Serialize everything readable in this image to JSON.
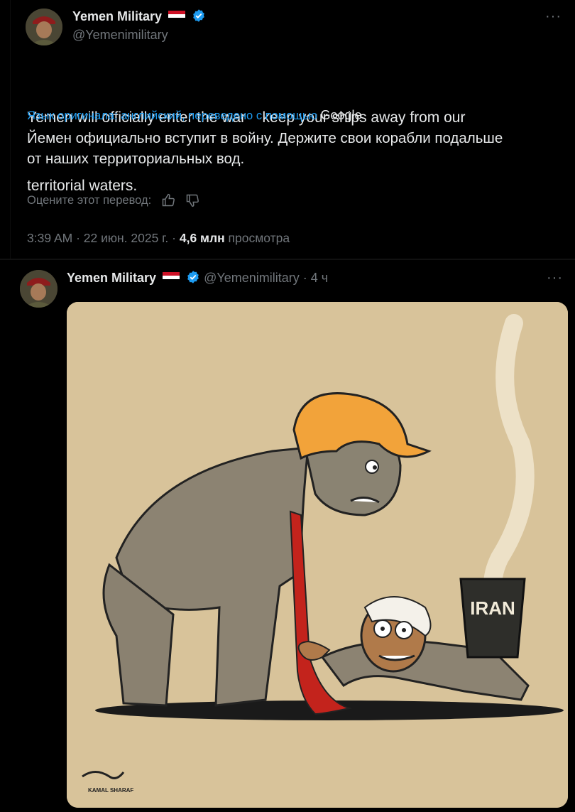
{
  "tweet1": {
    "display_name": "Yemen Military",
    "handle": "@Yemenimilitary",
    "text_line1": "Yemen will officially enter the war    keep your ships away from our",
    "text_line2": "territorial waters.",
    "translation_label": "Язык оригинала: английский, переведено с помощью",
    "translation_provider": "Google",
    "translated_line1": "Йемен официально вступит в войну. Держите свои корабли подальше",
    "translated_line2": "от наших территориальных вод.",
    "rate_translation": "Оцените этот перевод:",
    "timestamp": "3:39 AM · 22 июн. 2025 г. ·",
    "views_count": "4,6 млн",
    "views_label": "просмотра",
    "more": "···"
  },
  "tweet2": {
    "display_name": "Yemen Military",
    "handle": "@Yemenimilitary",
    "time": "· 4 ч",
    "more": "···",
    "image": {
      "bin_label": "IRAN",
      "signature": "KAMAL SHARAF"
    }
  },
  "colors": {
    "background": "#000000",
    "text": "#e7e9ea",
    "muted": "#71767b",
    "link": "#1d9bf0",
    "verified": "#1d9bf0",
    "cartoon_bg": "#d8c39a"
  },
  "icons": [
    "yemen-flag-icon",
    "verified-badge-icon",
    "thumbs-up-icon",
    "thumbs-down-icon",
    "more-icon"
  ]
}
